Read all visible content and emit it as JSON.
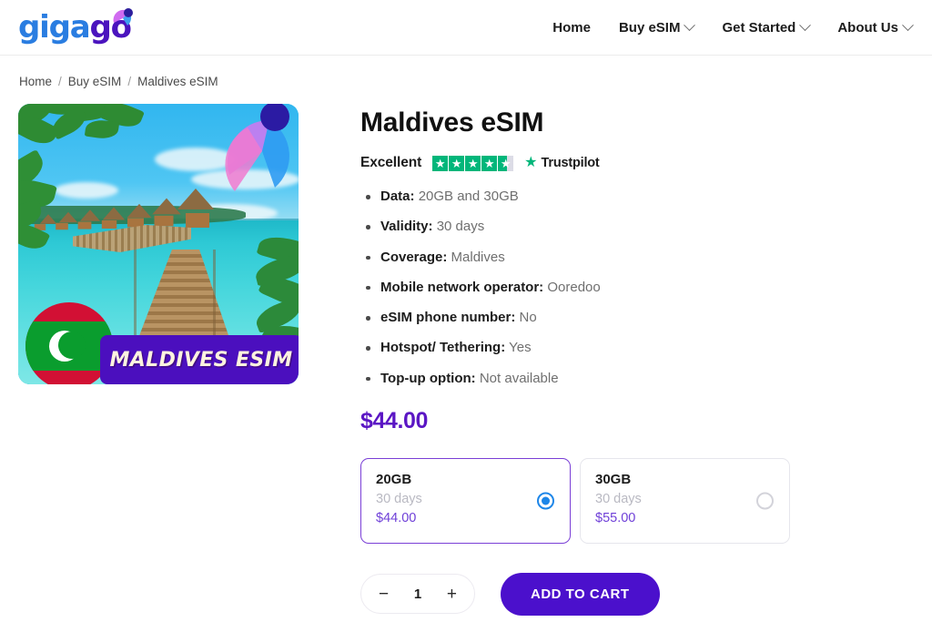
{
  "header": {
    "logo": {
      "part1": "giga",
      "part2": "go",
      "swoosh_icon": "gigago-swoosh-icon"
    },
    "nav": [
      {
        "label": "Home",
        "has_dropdown": false
      },
      {
        "label": "Buy eSIM",
        "has_dropdown": true
      },
      {
        "label": "Get Started",
        "has_dropdown": true
      },
      {
        "label": "About Us",
        "has_dropdown": true
      }
    ]
  },
  "breadcrumb": {
    "items": [
      "Home",
      "Buy eSIM",
      "Maldives eSIM"
    ],
    "separator": "/"
  },
  "product": {
    "title": "Maldives eSIM",
    "image": {
      "banner_text": "MALDIVES ESIM",
      "flag_name": "maldives-flag-badge",
      "alt": "Maldives overwater bungalows and wooden jetty"
    },
    "rating": {
      "word": "Excellent",
      "stars_filled": 4,
      "partial_fraction": 0.58,
      "total_stars": 5,
      "brand": "Trustpilot",
      "star_color": "#00b67a",
      "empty_color": "#dcdce6"
    },
    "specs": [
      {
        "label": "Data:",
        "value": "20GB and 30GB"
      },
      {
        "label": "Validity:",
        "value": "30 days"
      },
      {
        "label": "Coverage:",
        "value": "Maldives"
      },
      {
        "label": "Mobile network operator:",
        "value": "Ooredoo"
      },
      {
        "label": "eSIM phone number:",
        "value": "No"
      },
      {
        "label": "Hotspot/ Tethering:",
        "value": "Yes"
      },
      {
        "label": "Top-up option:",
        "value": "Not available"
      }
    ],
    "price": "$44.00",
    "price_color": "#5b16c4",
    "plans": [
      {
        "size": "20GB",
        "days": "30 days",
        "price": "$44.00",
        "selected": true
      },
      {
        "size": "30GB",
        "days": "30 days",
        "price": "$55.00",
        "selected": false
      }
    ],
    "quantity": {
      "decrement_label": "−",
      "value": "1",
      "increment_label": "+"
    },
    "add_to_cart_label": "ADD TO CART",
    "accent_color": "#4b10cc"
  }
}
